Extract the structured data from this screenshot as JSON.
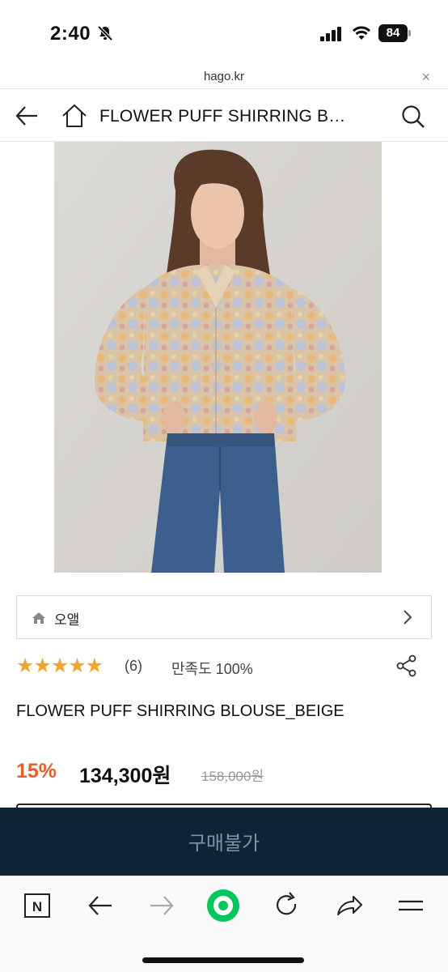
{
  "status_bar": {
    "time": "2:40",
    "battery": "84"
  },
  "browser": {
    "url": "hago.kr",
    "close_label": "×"
  },
  "header": {
    "title": "FLOWER PUFF SHIRRING B…"
  },
  "product": {
    "brand": "오앨",
    "stars": "★★★★★",
    "rating_fraction": 1.0,
    "review_count": "(6)",
    "satisfaction": "만족도 100%",
    "name": "FLOWER PUFF SHIRRING BLOUSE_BEIGE",
    "discount": "15%",
    "price": "134,300원",
    "original_price": "158,000원"
  },
  "buy_button": {
    "label": "구매불가"
  },
  "colors": {
    "star": "#f0a531",
    "discount": "#e2612d",
    "buy_bar": "#0d2536",
    "buy_label": "#7f93a3",
    "naver_green": "#03c75a"
  },
  "icons": {
    "back": "arrow-left-icon",
    "home": "home-icon",
    "search": "search-icon",
    "share": "share-icon",
    "toolbar": [
      "naver-n-icon",
      "back-arrow-icon",
      "forward-arrow-icon",
      "green-home-icon",
      "reload-icon",
      "share-arrow-icon",
      "menu-icon"
    ]
  }
}
